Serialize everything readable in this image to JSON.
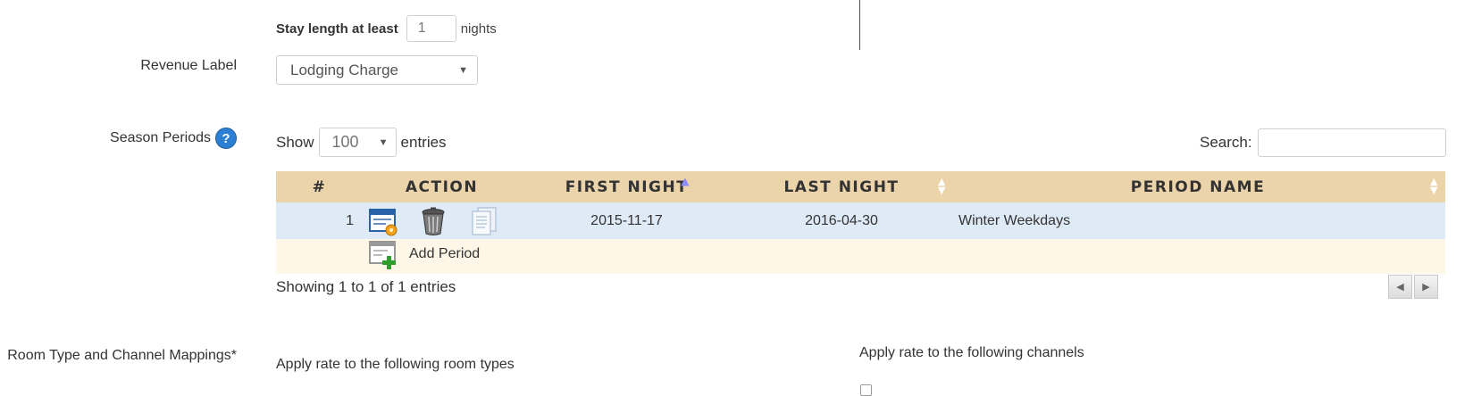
{
  "stay_length": {
    "label": "Stay length at least",
    "value": "1",
    "unit": "nights"
  },
  "revenue_label": {
    "label": "Revenue Label",
    "selected": "Lodging Charge"
  },
  "season_periods": {
    "label": "Season Periods",
    "help_icon": "?",
    "show_label": "Show",
    "page_size": "100",
    "entries_label": "entries",
    "search_label": "Search:",
    "search_value": "",
    "columns": [
      "#",
      "ACTION",
      "FIRST NIGHT",
      "LAST NIGHT",
      "PERIOD NAME"
    ],
    "sort": {
      "column": "FIRST NIGHT",
      "direction": "ascending"
    },
    "rows": [
      {
        "num": "1",
        "first_night": "2015-11-17",
        "last_night": "2016-04-30",
        "period_name": "Winter Weekdays"
      }
    ],
    "add_label": "Add Period",
    "info": "Showing 1 to 1 of 1 entries",
    "action_icons": [
      "edit-icon",
      "trash-icon",
      "copy-icon"
    ]
  },
  "mappings": {
    "label": "Room Type and Channel Mappings*",
    "room_types_label": "Apply rate to the following room types",
    "channels_label": "Apply rate to the following channels"
  },
  "colors": {
    "header_bg": "#ebd3aa",
    "row_bg": "#dfeaf7",
    "add_row_bg": "#fef6e6",
    "sort_active": "#8a8cff"
  }
}
